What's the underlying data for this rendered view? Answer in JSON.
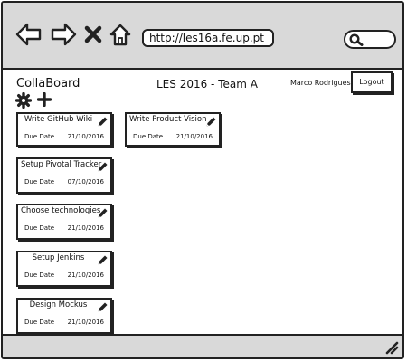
{
  "browser": {
    "url": "http://les16a.fe.up.pt"
  },
  "header": {
    "brand": "CollaBoard",
    "team": "LES 2016 - Team A",
    "user": "Marco Rodrigues",
    "logout_label": "Logout"
  },
  "toolbar": {
    "settings_icon": "gear-icon",
    "add_icon": "plus-icon"
  },
  "cards": [
    {
      "title": "Write GitHub Wiki",
      "due_label": "Due Date",
      "due": "21/10/2016"
    },
    {
      "title": "Write Product Vision",
      "due_label": "Due Date",
      "due": "21/10/2016"
    },
    {
      "title": "Setup Pivotal Tracker",
      "due_label": "Due Date",
      "due": "07/10/2016"
    },
    {
      "title": "Choose technologies",
      "due_label": "Due Date",
      "due": "21/10/2016"
    },
    {
      "title": "Setup Jenkins",
      "due_label": "Due Date",
      "due": "21/10/2016"
    },
    {
      "title": "Design Mockus",
      "due_label": "Due Date",
      "due": "21/10/2016"
    }
  ]
}
